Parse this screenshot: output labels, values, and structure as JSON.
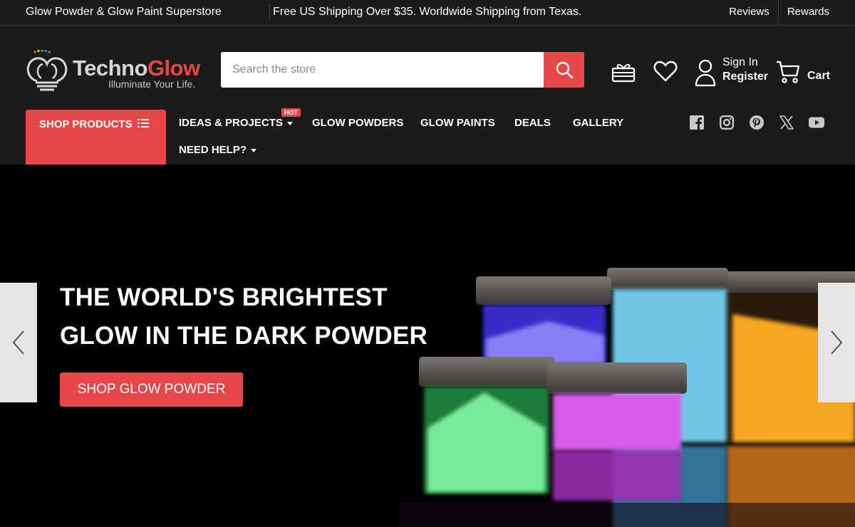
{
  "topbar": {
    "tagline": "Glow Powder & Glow Paint Superstore",
    "shipping": "Free US Shipping Over $35. Worldwide Shipping from Texas.",
    "reviews": "Reviews",
    "rewards": "Rewards"
  },
  "header": {
    "logo_part1": "Techno",
    "logo_part2": "Glow",
    "logo_tagline": "Illuminate Your Life.",
    "search_placeholder": "Search the store",
    "sign_in": "Sign In",
    "register": "Register",
    "cart": "Cart"
  },
  "nav": {
    "shop_products": "SHOP PRODUCTS",
    "items": [
      {
        "label": "IDEAS & PROJECTS"
      },
      {
        "label": "GLOW POWDERS"
      },
      {
        "label": "GLOW PAINTS"
      },
      {
        "label": "DEALS"
      },
      {
        "label": "GALLERY"
      },
      {
        "label": "NEED HELP?"
      }
    ],
    "hot_badge": "HOT"
  },
  "social": [
    "facebook-icon",
    "instagram-icon",
    "pinterest-icon",
    "x-icon",
    "youtube-icon"
  ],
  "hero": {
    "line1": "THE WORLD'S BRIGHTEST",
    "line2": "GLOW IN THE DARK POWDER",
    "cta": "SHOP GLOW POWDER"
  },
  "colors": {
    "accent": "#e8474a",
    "background": "#1b1b1b",
    "hero_bg": "#000000"
  }
}
